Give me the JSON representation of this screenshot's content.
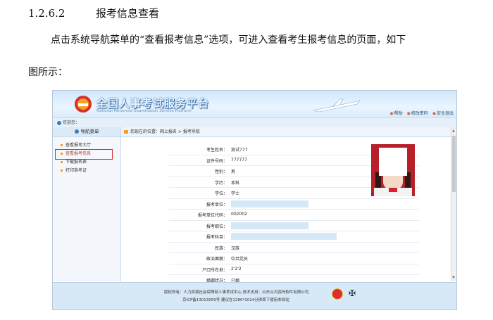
{
  "doc": {
    "section_number": "1.2.6.2",
    "section_title": "报考信息查看",
    "paragraph_line1": "点击系统导航菜单的“查看报考信息”选项，可进入查看考生报考信息的页面，如下",
    "paragraph_line2": "图所示："
  },
  "screenshot": {
    "site_title": "全国人事考试服务平台",
    "site_subtitle": "National Personnel Examination Service Platform",
    "top_links": [
      "帮助",
      "修改密码",
      "安全退出"
    ],
    "welcome": "欢迎您：",
    "sidebar": {
      "header": "导航菜单",
      "items": [
        "查看报考大厅",
        "查看报考信息",
        "下载报名表",
        "打印准考证"
      ],
      "active_index": 1
    },
    "breadcrumb": "您现在的位置：网上报名 > 报考导航",
    "form_rows": [
      {
        "label": "考生姓名：",
        "value": "测试777"
      },
      {
        "label": "证件号码：",
        "value": "777777"
      },
      {
        "label": "性别：",
        "value": "男"
      },
      {
        "label": "学历：",
        "value": "本科"
      },
      {
        "label": "学位：",
        "value": "学士"
      },
      {
        "label": "报考单位：",
        "value": ""
      },
      {
        "label": "报考单位代码：",
        "value": "002002"
      },
      {
        "label": "报考职位：",
        "value": ""
      },
      {
        "label": "报考科目：",
        "value": ""
      },
      {
        "label": "民族：",
        "value": "汉族"
      },
      {
        "label": "政治面貌：",
        "value": "中共党员"
      },
      {
        "label": "户口所在地：",
        "value": "2'2'2"
      },
      {
        "label": "婚姻状况：",
        "value": "已婚"
      }
    ],
    "footer": {
      "line1": "版权所有：人力资源社会保障部人事考试中心  技术支持：山东山大鸥玛软件有限公司",
      "line2": "京ICP备13013059号  建议在1280*1024分辨率下使用本网站"
    },
    "colors": {
      "highlight_box": "#d9292b",
      "banner": "#cfe7fb",
      "mask": "#d4e8f6"
    }
  }
}
